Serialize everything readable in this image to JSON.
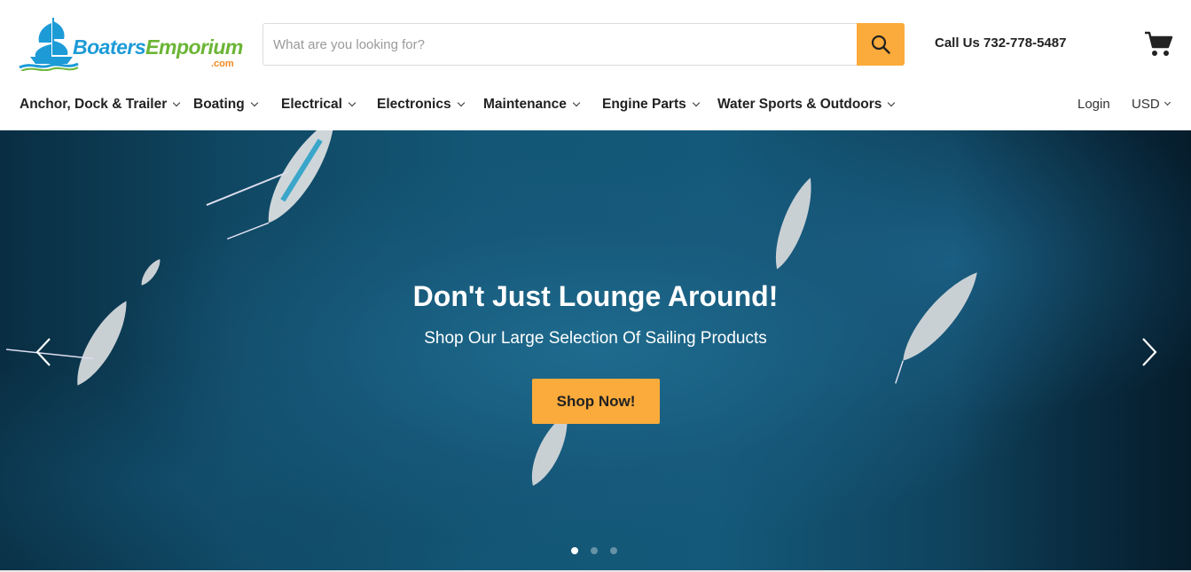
{
  "header": {
    "logo": {
      "part1": "Boaters",
      "part2": "Emporium",
      "suffix": ".com",
      "colors": {
        "primary": "#1d9bd7",
        "secondary": "#6bb535",
        "accent": "#f08a24"
      }
    },
    "search": {
      "placeholder": "What are you looking for?",
      "value": "",
      "button_icon": "search-icon",
      "button_color": "#fbab3b"
    },
    "phone": "Call Us 732-778-5487",
    "cart_icon": "cart-icon"
  },
  "nav": {
    "items": [
      {
        "label": "Anchor, Dock & Trailer"
      },
      {
        "label": "Boating"
      },
      {
        "label": "Electrical"
      },
      {
        "label": "Electronics"
      },
      {
        "label": "Maintenance"
      },
      {
        "label": "Engine Parts"
      },
      {
        "label": "Water Sports & Outdoors"
      }
    ],
    "login": "Login",
    "currency": "USD"
  },
  "hero": {
    "title": "Don't Just Lounge Around!",
    "subtitle": "Shop Our Large Selection Of Sailing Products",
    "button": "Shop Now!",
    "button_color": "#fbab3b",
    "slides": {
      "count": 3,
      "active": 1
    }
  }
}
